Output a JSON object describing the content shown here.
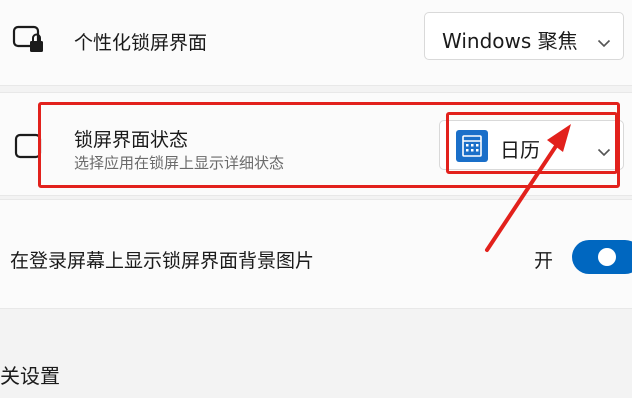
{
  "lock_screen_personalize": {
    "label": "个性化锁屏界面",
    "selected": "Windows 聚焦",
    "icon": "monitor-lock-icon"
  },
  "lock_screen_status": {
    "label": "锁屏界面状态",
    "description": "选择应用在锁屏上显示详细状态",
    "selected": "日历",
    "selected_icon": "calendar-icon"
  },
  "sign_in_background": {
    "label": "在登录屏幕上显示锁屏界面背景图片",
    "state_label": "开",
    "is_on": true
  },
  "related_settings": {
    "title": "关设置"
  },
  "annotation": {
    "color": "#e2211c"
  },
  "colors": {
    "accent": "#0067c0",
    "app_icon_bg": "#1a6fc9"
  }
}
